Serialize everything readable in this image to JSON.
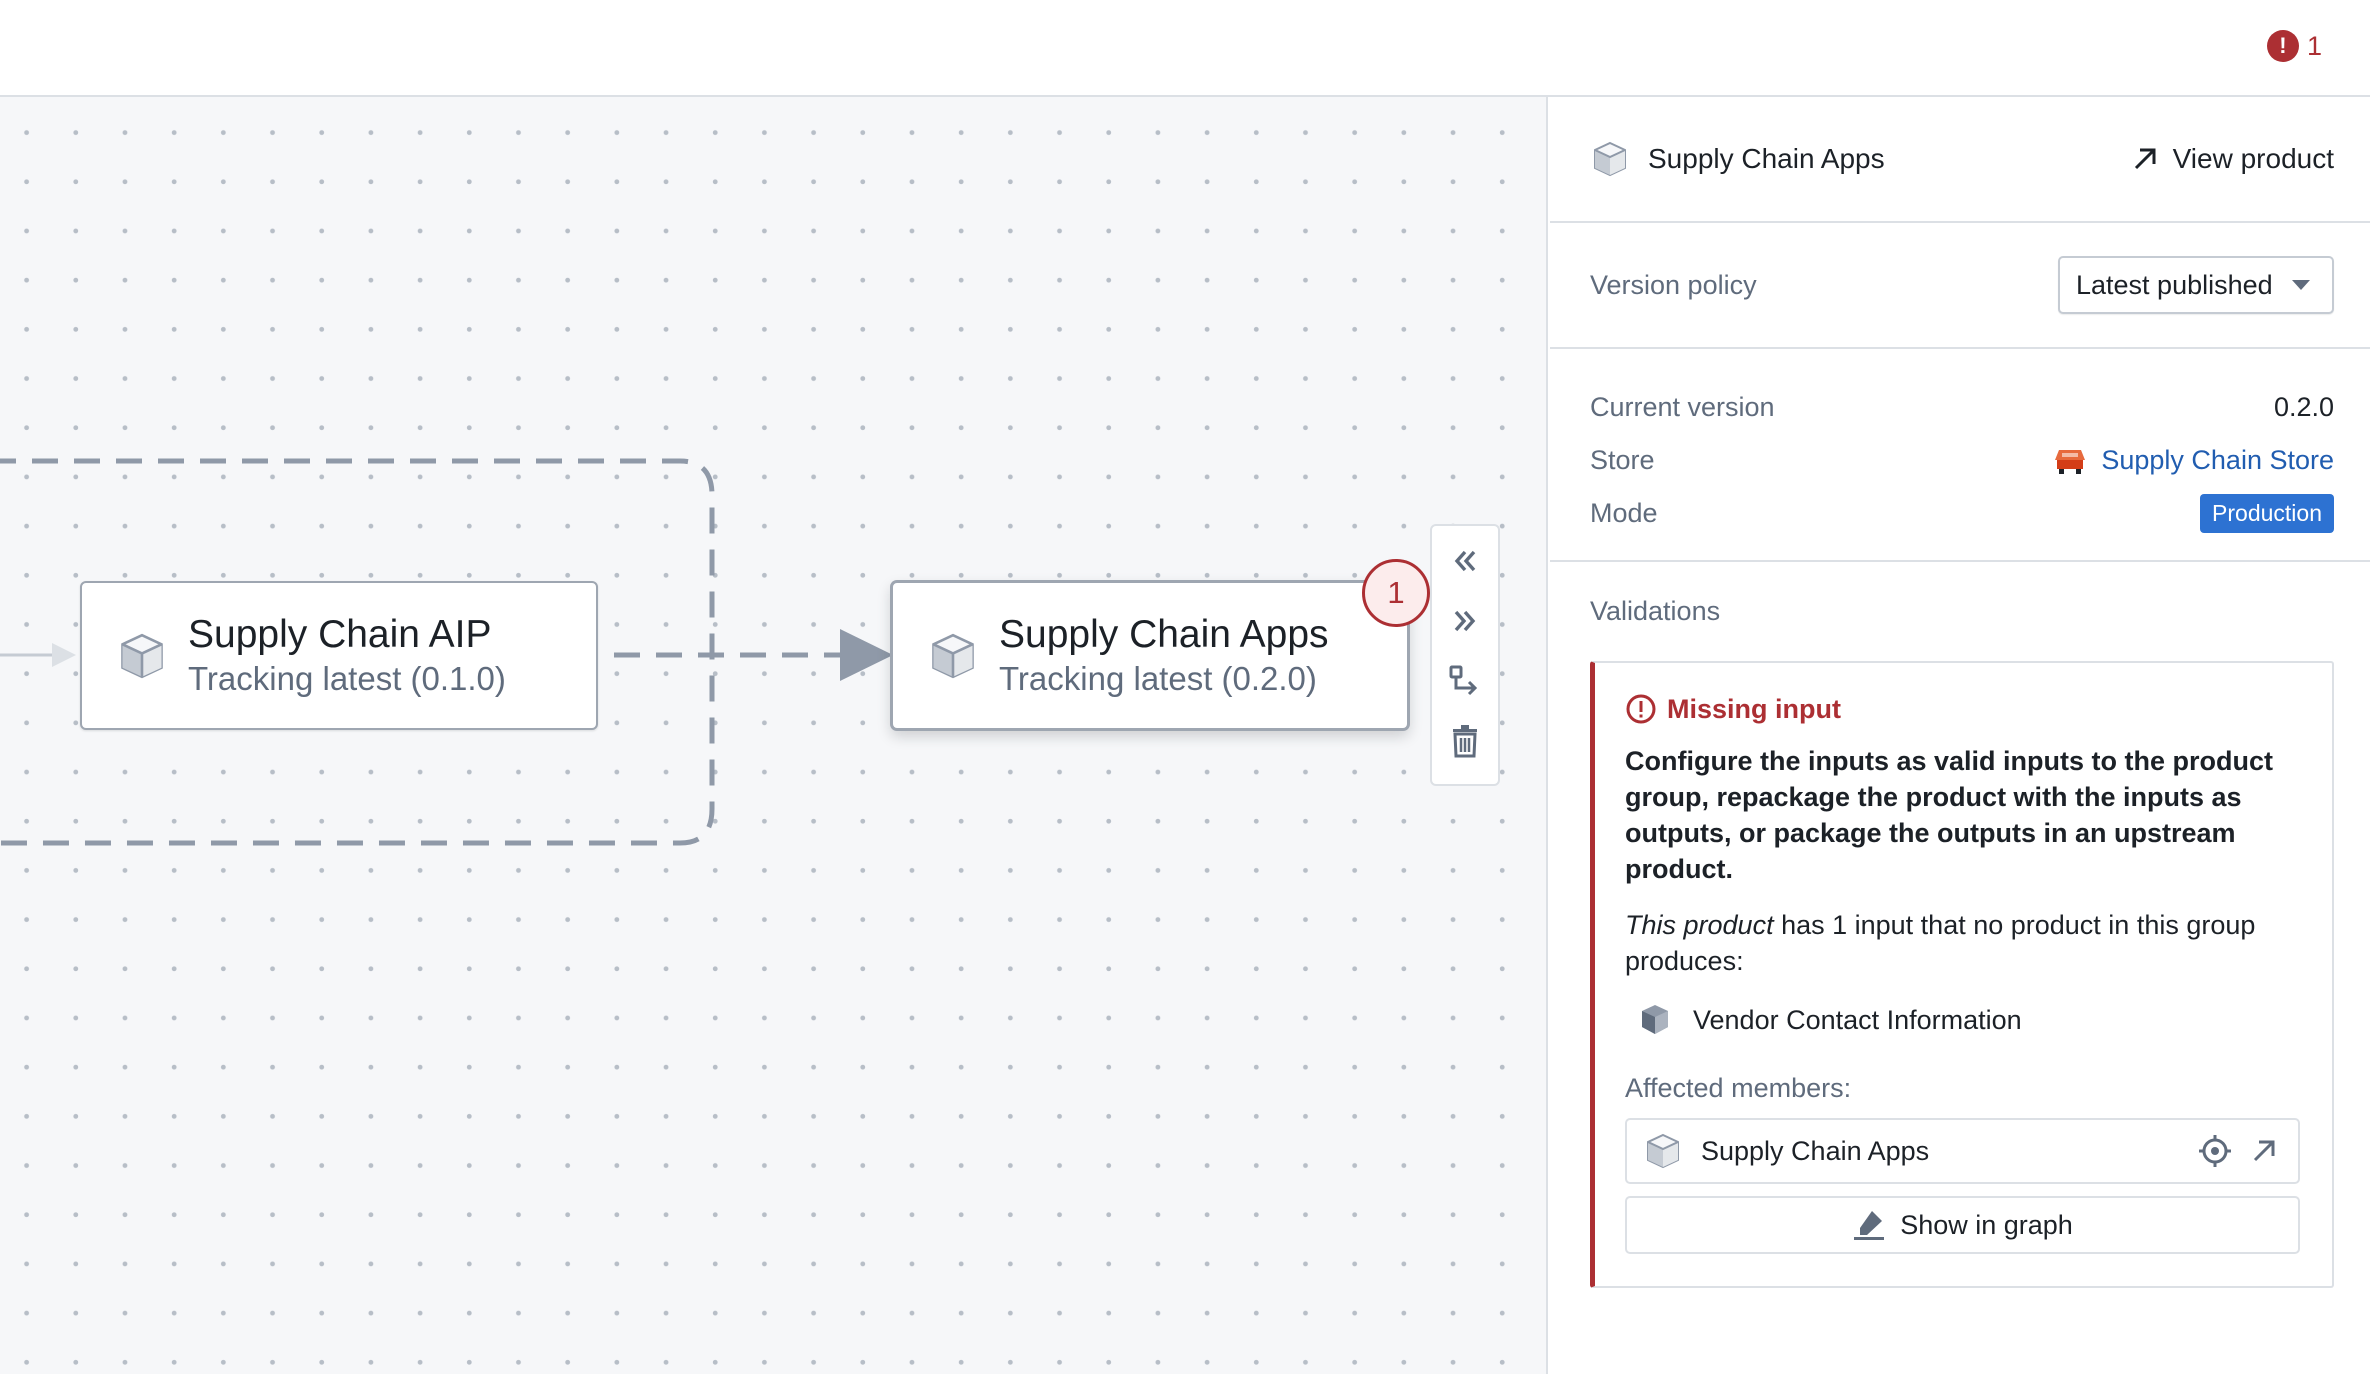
{
  "topbar": {
    "error_count": "1"
  },
  "graph": {
    "nodes": [
      {
        "title": "Supply Chain AIP",
        "subtitle": "Tracking latest (0.1.0)"
      },
      {
        "title": "Supply Chain Apps",
        "subtitle": "Tracking latest (0.2.0)",
        "badge": "1"
      }
    ]
  },
  "panel": {
    "header": {
      "title": "Supply Chain Apps",
      "view_label": "View product"
    },
    "version_policy": {
      "label": "Version policy",
      "selected": "Latest published"
    },
    "details": {
      "current_version_label": "Current version",
      "current_version": "0.2.0",
      "store_label": "Store",
      "store": "Supply Chain Store",
      "mode_label": "Mode",
      "mode": "Production"
    },
    "validations": {
      "title": "Validations",
      "error_title": "Missing input",
      "error_body": "Configure the inputs as valid inputs to the product group, repackage the product with the inputs as outputs, or package the outputs in an upstream product.",
      "desc_em": "This product",
      "desc_rest": " has 1 input that no product in this group produces:",
      "input_name": "Vendor Contact Information",
      "affected_label": "Affected members:",
      "member_name": "Supply Chain Apps",
      "show_graph_label": "Show in graph"
    }
  },
  "colors": {
    "error": "#ac2f33",
    "link": "#215db0",
    "production": "#2d72d2",
    "edge": "#8f99a8"
  }
}
